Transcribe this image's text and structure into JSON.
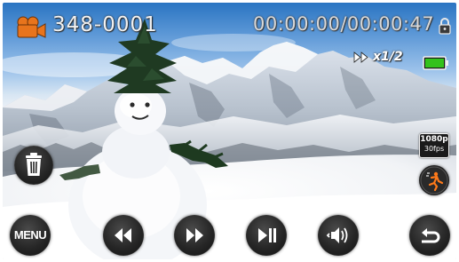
{
  "header": {
    "file_number": "348-0001",
    "time_code": "00:00:00/00:00:47",
    "playback_speed": "x1/2"
  },
  "status": {
    "resolution_line1": "1080p",
    "resolution_line2": "30fps",
    "battery_level": 1.0
  },
  "controls": {
    "menu_label": "MENU"
  },
  "icons": {
    "camera": "video-camera-icon",
    "lock": "lock-icon",
    "speed": "fast-forward-icon",
    "battery": "battery-icon",
    "stabilizer": "image-stabilizer-icon",
    "delete": "trash-icon",
    "rewind": "rewind-icon",
    "forward": "fast-forward-icon",
    "play_pause": "play-pause-icon",
    "volume": "volume-icon",
    "back": "return-icon"
  },
  "colors": {
    "camera_icon": "#e8741c",
    "battery_fill": "#33c21b",
    "overlay_text": "#f2f2f2",
    "button_bg": "#262626"
  }
}
